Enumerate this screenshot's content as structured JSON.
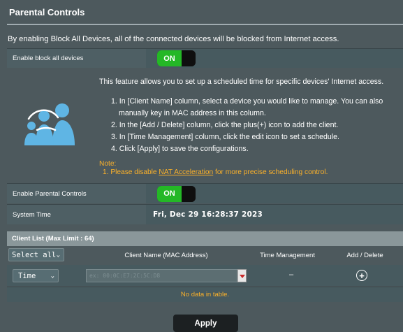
{
  "title": "Parental Controls",
  "description": "By enabling Block All Devices, all of the connected devices will be blocked from Internet access.",
  "block_all": {
    "label": "Enable block all devices",
    "state": "ON"
  },
  "info": {
    "intro": "This feature allows you to set up a scheduled time for specific devices' Internet access.",
    "steps": [
      "1. In [Client Name] column, select a device you would like to manage. You can also",
      "manually key in MAC address in this column.",
      "2. In the [Add / Delete] column, click the plus(+) icon to add the client.",
      "3. In [Time Management] column, click the edit icon to set a schedule.",
      "4. Click [Apply] to save the configurations."
    ],
    "note_label": "Note:",
    "note_prefix": "1. Please disable ",
    "note_link": "NAT Acceleration",
    "note_suffix": " for more precise scheduling control.",
    "icon": "family-icon"
  },
  "parental": {
    "label": "Enable Parental Controls",
    "state": "ON"
  },
  "system_time": {
    "label": "System Time",
    "value": "Fri, Dec 29 16:28:37 2023"
  },
  "client_list": {
    "title": "Client List (Max Limit : 64)",
    "select_all": "Select all",
    "columns": [
      "Client Name (MAC Address)",
      "Time Management",
      "Add / Delete"
    ],
    "entry": {
      "time_select": "Time",
      "mac_placeholder": "ex: 00:0C:E7:2C:5C:D8",
      "time_mgmt": "–"
    },
    "empty": "No data in table."
  },
  "apply": "Apply",
  "colors": {
    "accent_green": "#24b826",
    "note_orange": "#fbb12a",
    "bg": "#4d595d"
  }
}
